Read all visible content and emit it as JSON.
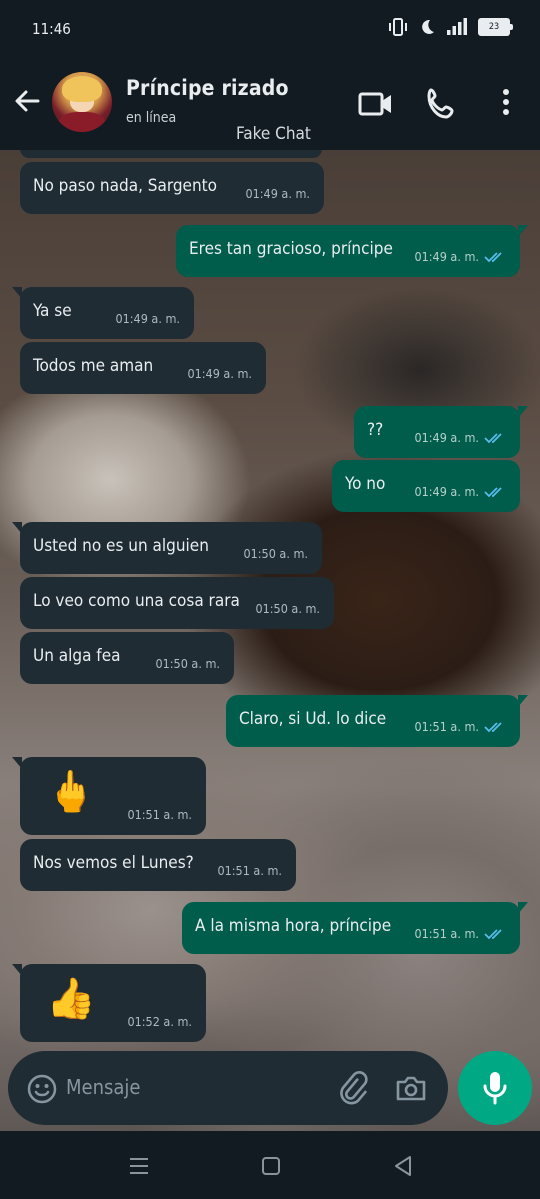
{
  "status_bar": {
    "time": "11:46",
    "battery": "23"
  },
  "header": {
    "contact_name": "Príncipe rizado",
    "contact_status": "en línea",
    "watermark": "Fake Chat"
  },
  "messages": [
    {
      "dir": "in",
      "text": "No paso nada, Sargento",
      "time": "01:49 a. m."
    },
    {
      "dir": "out",
      "text": "Eres tan gracioso, príncipe",
      "time": "01:49 a. m."
    },
    {
      "dir": "in",
      "text": "Ya se",
      "time": "01:49 a. m."
    },
    {
      "dir": "in",
      "text": "Todos me aman",
      "time": "01:49 a. m."
    },
    {
      "dir": "out",
      "text": "??",
      "time": "01:49 a. m."
    },
    {
      "dir": "out",
      "text": "Yo no",
      "time": "01:49 a. m."
    },
    {
      "dir": "in",
      "text": "Usted no es un alguien",
      "time": "01:50 a. m."
    },
    {
      "dir": "in",
      "text": "Lo veo como una cosa rara",
      "time": "01:50 a. m."
    },
    {
      "dir": "in",
      "text": "Un alga fea",
      "time": "01:50 a. m."
    },
    {
      "dir": "out",
      "text": "Claro, si Ud. lo dice",
      "time": "01:51 a. m."
    },
    {
      "dir": "in",
      "text": "🖕",
      "time": "01:51 a. m."
    },
    {
      "dir": "in",
      "text": "Nos vemos el Lunes?",
      "time": "01:51 a. m."
    },
    {
      "dir": "out",
      "text": "A la misma hora, príncipe",
      "time": "01:51 a. m."
    },
    {
      "dir": "in",
      "text": "👍",
      "time": "01:52 a. m."
    }
  ],
  "composer": {
    "placeholder": "Mensaje"
  },
  "colors": {
    "incoming_bubble": "#1f2c34",
    "outgoing_bubble": "#005c4b",
    "read_ticks": "#53bdeb",
    "mic_button": "#00a884"
  }
}
